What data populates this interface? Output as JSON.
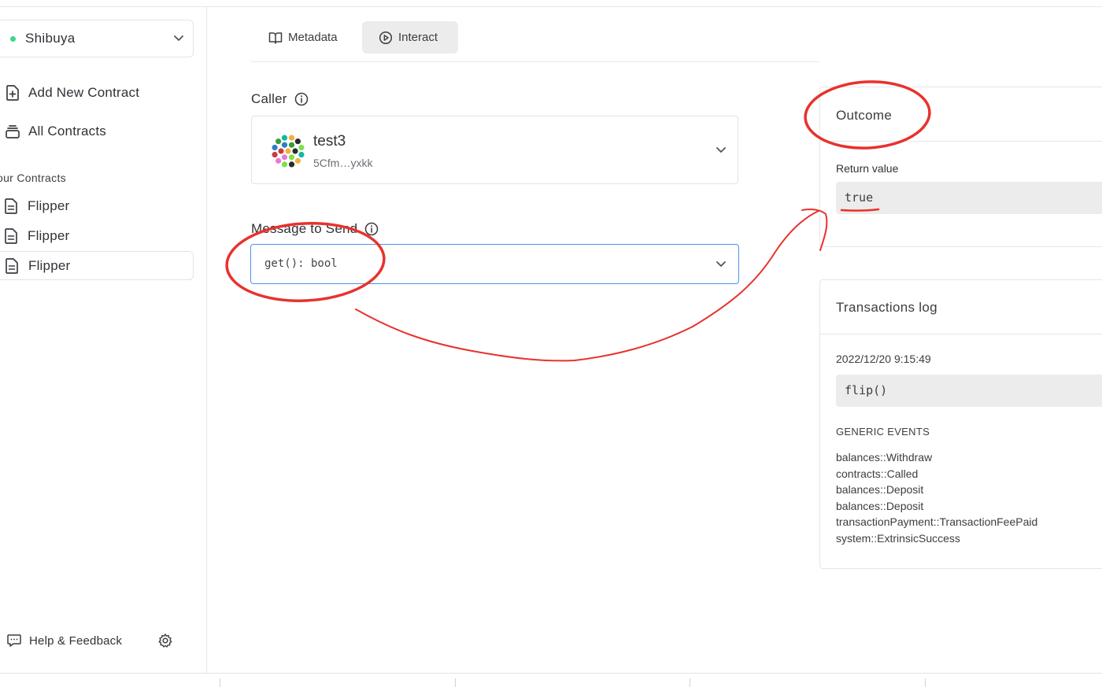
{
  "sidebar": {
    "network": {
      "label": "Shibuya",
      "status_color": "#3dd68c"
    },
    "nav": [
      {
        "label": "Add New Contract",
        "icon": "file-plus-icon"
      },
      {
        "label": "All Contracts",
        "icon": "stack-icon"
      }
    ],
    "section_label": "our Contracts",
    "contracts": [
      {
        "label": "Flipper",
        "icon": "document-icon"
      },
      {
        "label": "Flipper",
        "icon": "document-icon"
      },
      {
        "label": "Flipper",
        "icon": "document-icon",
        "active": true
      }
    ],
    "help_label": "Help & Feedback"
  },
  "tabs": [
    {
      "label": "Metadata",
      "icon": "book-icon"
    },
    {
      "label": "Interact",
      "icon": "play-circle-icon",
      "active": true
    }
  ],
  "caller": {
    "label": "Caller",
    "name": "test3",
    "address": "5Cfm…yxkk"
  },
  "message": {
    "label": "Message to Send",
    "value": "get(): bool"
  },
  "outcome": {
    "title": "Outcome",
    "return_label": "Return value",
    "return_value": "true"
  },
  "transactions": {
    "title": "Transactions log",
    "timestamp": "2022/12/20 9:15:49",
    "call": "flip()",
    "events_label": "GENERIC EVENTS",
    "events": [
      "balances::Withdraw",
      "contracts::Called",
      "balances::Deposit",
      "balances::Deposit",
      "transactionPayment::TransactionFeePaid",
      "system::ExtrinsicSuccess"
    ]
  },
  "colors": {
    "accent_border": "#4f8ff0",
    "annotation_red": "#e8322d",
    "active_tab_bg": "#ececec"
  }
}
